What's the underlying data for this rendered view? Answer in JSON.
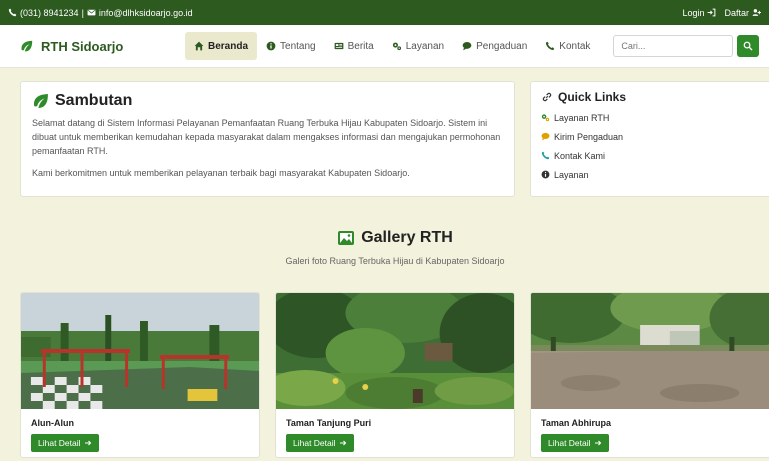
{
  "topbar": {
    "phone": "(031) 8941234",
    "separator": "|",
    "email": "info@dlhksidoarjo.go.id",
    "login": "Login",
    "register": "Daftar"
  },
  "navbar": {
    "brand": "RTH Sidoarjo",
    "items": [
      {
        "label": "Beranda",
        "icon": "home-icon"
      },
      {
        "label": "Tentang",
        "icon": "info-icon"
      },
      {
        "label": "Berita",
        "icon": "newspaper-icon"
      },
      {
        "label": "Layanan",
        "icon": "cogs-icon"
      },
      {
        "label": "Pengaduan",
        "icon": "comment-icon"
      },
      {
        "label": "Kontak",
        "icon": "phone-icon"
      }
    ],
    "search_placeholder": "Cari..."
  },
  "welcome": {
    "title": "Sambutan",
    "paragraph1": "Selamat datang di Sistem Informasi Pelayanan Pemanfaatan Ruang Terbuka Hijau Kabupaten Sidoarjo. Sistem ini dibuat untuk memberikan kemudahan kepada masyarakat dalam mengakses informasi dan mengajukan permohonan pemanfaatan RTH.",
    "paragraph2": "Kami berkomitmen untuk memberikan pelayanan terbaik bagi masyarakat Kabupaten Sidoarjo."
  },
  "quick_links": {
    "title": "Quick Links",
    "items": [
      {
        "label": "Layanan RTH",
        "icon": "cogs-icon"
      },
      {
        "label": "Kirim Pengaduan",
        "icon": "comment-icon"
      },
      {
        "label": "Kontak Kami",
        "icon": "phone-icon"
      },
      {
        "label": "Layanan",
        "icon": "info-icon"
      }
    ]
  },
  "gallery": {
    "title": "Gallery RTH",
    "subtitle": "Galeri foto Ruang Terbuka Hijau di Kabupaten Sidoarjo",
    "items": [
      {
        "name": "Alun-Alun",
        "button": "Lihat Detail"
      },
      {
        "name": "Taman Tanjung Puri",
        "button": "Lihat Detail"
      },
      {
        "name": "Taman Abhirupa",
        "button": "Lihat Detail"
      }
    ]
  },
  "colors": {
    "primary_dark": "#2c5a1f",
    "primary": "#2f8a2a",
    "background": "#f3f2dc",
    "nav_active": "#ebe9cd"
  }
}
